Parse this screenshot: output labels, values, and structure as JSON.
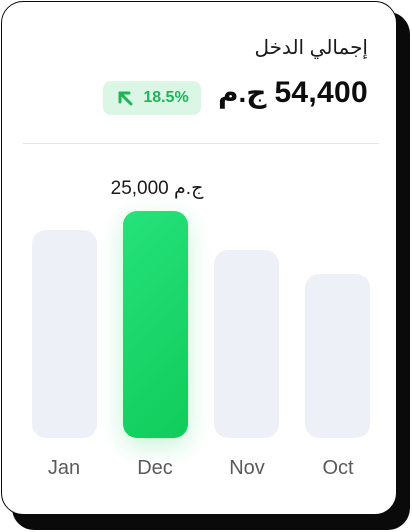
{
  "card": {
    "title": "إجمالي الدخل",
    "total_value": "54,400",
    "currency": "ج.م",
    "change_badge": "18.5%",
    "change_icon": "arrow-up-left-icon"
  },
  "chart_data": {
    "type": "bar",
    "categories": [
      "Jan",
      "Dec",
      "Nov",
      "Oct"
    ],
    "highlighted_category": "Dec",
    "highlighted_label": "25,000 ج.م",
    "colors": {
      "highlight": "#1ed46a",
      "default": "#eef0f7",
      "badge_bg": "#dcf6e6",
      "badge_text": "#1fb458"
    }
  }
}
